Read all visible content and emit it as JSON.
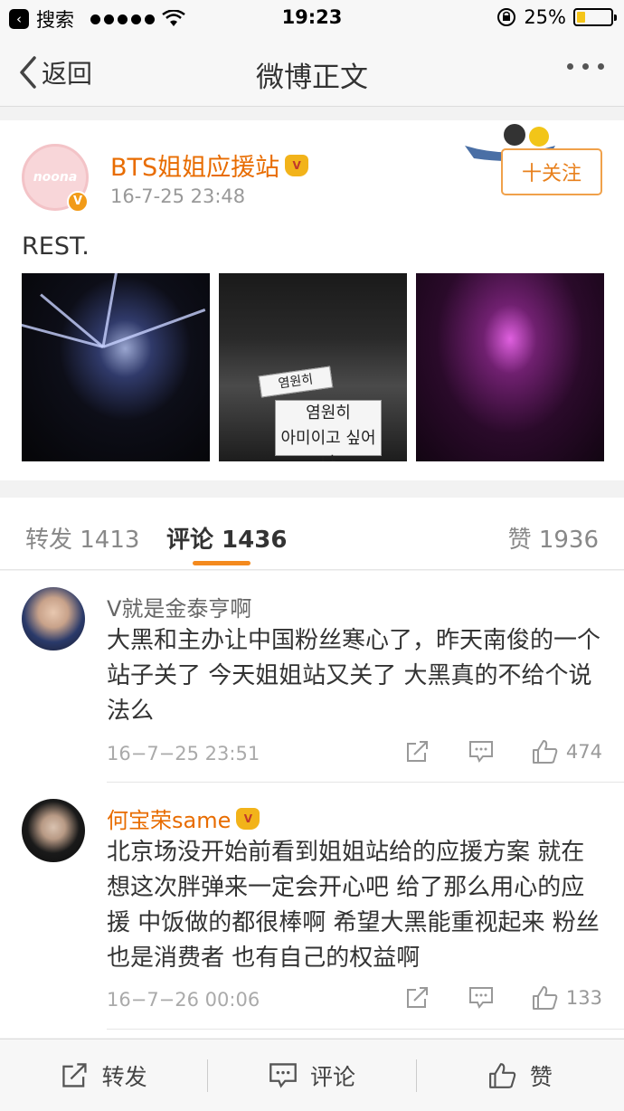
{
  "status_bar": {
    "back_app": "搜索",
    "time": "19:23",
    "battery": "25%",
    "battery_level": 0.25
  },
  "nav": {
    "back_label": "返回",
    "title": "微博正文"
  },
  "post": {
    "author": "BTS姐姐应援站",
    "timestamp": "16-7-25 23:48",
    "follow_label": "十关注",
    "text": "REST.",
    "avatar_text": "noona"
  },
  "tabs": {
    "repost": "转发 1413",
    "comment": "评论 1436",
    "like": "赞 1936"
  },
  "comments": [
    {
      "user": "V就是金泰亨啊",
      "text": "大黑和主办让中国粉丝寒心了，昨天南俊的一个站子关了 今天姐姐站又关了 大黑真的不给个说法么",
      "time": "16−7−25 23:51",
      "likes": "474"
    },
    {
      "user": "何宝荣same",
      "text": "北京场没开始前看到姐姐站给的应援方案 就在想这次胖弹来一定会开心吧 给了那么用心的应援 中饭做的都很棒啊 希望大黑能重视起来 粉丝也是消费者 也有自己的权益啊",
      "time": "16−7−26 00:06",
      "likes": "133"
    }
  ],
  "bottom_bar": {
    "repost": "转发",
    "comment": "评论",
    "like": "赞"
  },
  "colors": {
    "accent_orange": "#e86c00",
    "tab_underline": "#f48a1e",
    "follow_border": "#f0a14a"
  }
}
